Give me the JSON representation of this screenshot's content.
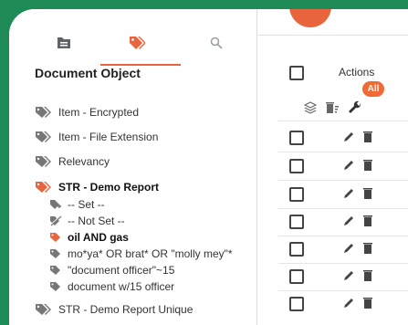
{
  "tabs": [
    {
      "name": "folder-tab",
      "icon": "folder-icon"
    },
    {
      "name": "tags-tab",
      "icon": "tags-icon",
      "active": true
    },
    {
      "name": "search-tab",
      "icon": "search-icon"
    }
  ],
  "left": {
    "title": "Document Object",
    "items": [
      {
        "label": "Item - Encrypted"
      },
      {
        "label": "Item - File Extension"
      },
      {
        "label": "Relevancy"
      },
      {
        "label": "STR - Demo Report"
      },
      {
        "label": "STR - Demo Report Unique"
      }
    ],
    "subitems": [
      {
        "label": "-- Set --"
      },
      {
        "label": "-- Not Set --"
      },
      {
        "label": "oil AND gas"
      },
      {
        "label": "mo*ya* OR brat* OR \"molly mey\"*"
      },
      {
        "label": "\"document officer\"~15"
      },
      {
        "label": "document w/15 officer"
      }
    ]
  },
  "right": {
    "actions_label": "Actions",
    "all_badge": "All",
    "row_count": 7
  },
  "colors": {
    "accent": "#e8643c",
    "badge": "#f06a35",
    "icon": "#5f6368",
    "bg": "#1e8a55"
  }
}
